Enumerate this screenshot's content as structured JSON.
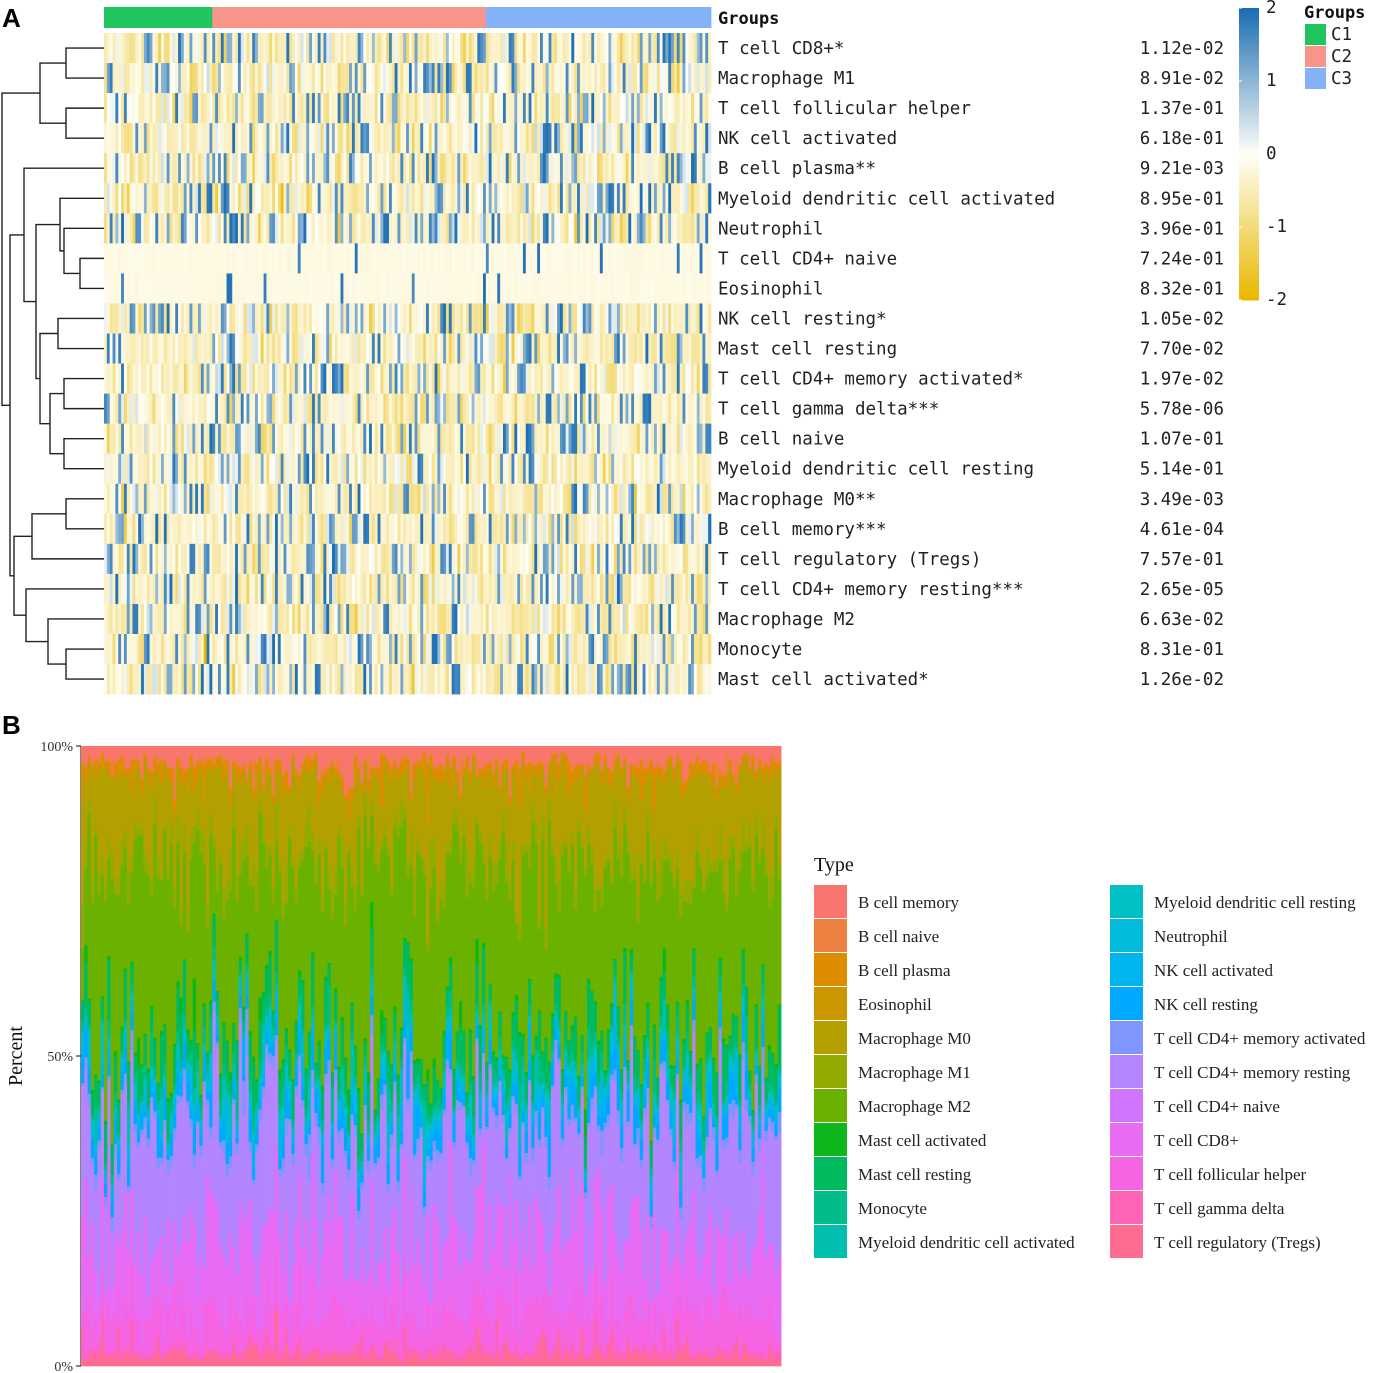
{
  "panels": {
    "a": "A",
    "b": "B"
  },
  "chart_data": [
    {
      "type": "heatmap",
      "title": "",
      "annotation_title": "Groups",
      "groups": [
        {
          "name": "C1",
          "color": "#21C55D",
          "n_samples": 38
        },
        {
          "name": "C2",
          "color": "#F8958A",
          "n_samples": 96
        },
        {
          "name": "C3",
          "color": "#84B2F7",
          "n_samples": 79
        }
      ],
      "rows": [
        {
          "label": "T cell CD8+*",
          "pvalue": "1.12e-02"
        },
        {
          "label": "Macrophage M1",
          "pvalue": "8.91e-02"
        },
        {
          "label": "T cell follicular helper",
          "pvalue": "1.37e-01"
        },
        {
          "label": "NK cell activated",
          "pvalue": "6.18e-01"
        },
        {
          "label": "B cell plasma**",
          "pvalue": "9.21e-03"
        },
        {
          "label": "Myeloid dendritic cell activated",
          "pvalue": "8.95e-01"
        },
        {
          "label": "Neutrophil",
          "pvalue": "3.96e-01"
        },
        {
          "label": "T cell CD4+ naive",
          "pvalue": "7.24e-01"
        },
        {
          "label": "Eosinophil",
          "pvalue": "8.32e-01"
        },
        {
          "label": "NK cell resting*",
          "pvalue": "1.05e-02"
        },
        {
          "label": "Mast cell resting",
          "pvalue": "7.70e-02"
        },
        {
          "label": "T cell CD4+ memory activated*",
          "pvalue": "1.97e-02"
        },
        {
          "label": "T cell gamma delta***",
          "pvalue": "5.78e-06"
        },
        {
          "label": "B cell naive",
          "pvalue": "1.07e-01"
        },
        {
          "label": "Myeloid dendritic cell resting",
          "pvalue": "5.14e-01"
        },
        {
          "label": "Macrophage M0**",
          "pvalue": "3.49e-03"
        },
        {
          "label": "B cell memory***",
          "pvalue": "4.61e-04"
        },
        {
          "label": "T cell regulatory (Tregs)",
          "pvalue": "7.57e-01"
        },
        {
          "label": "T cell CD4+ memory resting***",
          "pvalue": "2.65e-05"
        },
        {
          "label": "Macrophage M2",
          "pvalue": "6.63e-02"
        },
        {
          "label": "Monocyte",
          "pvalue": "8.31e-01"
        },
        {
          "label": "Mast cell activated*",
          "pvalue": "1.26e-02"
        }
      ],
      "color_scale": {
        "min": -2,
        "max": 2,
        "ticks": [
          2,
          1,
          0,
          -1,
          -2
        ],
        "low": "#E8B800",
        "mid": "#FFFFF8",
        "high": "#1C6EB4"
      },
      "legend_title": "Groups",
      "legend_labels": [
        "C1",
        "C2",
        "C3"
      ]
    },
    {
      "type": "bar",
      "stacked": true,
      "ylabel": "Percent",
      "yticks": [
        "0%",
        "50%",
        "100%"
      ],
      "ylim": [
        0,
        100
      ],
      "n_samples": 213,
      "legend_title": "Type",
      "legend": [
        {
          "name": "B cell memory",
          "color": "#F8766D"
        },
        {
          "name": "B cell naive",
          "color": "#EE8042"
        },
        {
          "name": "B cell plasma",
          "color": "#DF8B00"
        },
        {
          "name": "Eosinophil",
          "color": "#CB9600"
        },
        {
          "name": "Macrophage M0",
          "color": "#B3A000"
        },
        {
          "name": "Macrophage M1",
          "color": "#94AA00"
        },
        {
          "name": "Macrophage M2",
          "color": "#6AB100"
        },
        {
          "name": "Mast cell activated",
          "color": "#0BB71A"
        },
        {
          "name": "Mast cell resting",
          "color": "#00BA5F"
        },
        {
          "name": "Monocyte",
          "color": "#00BD8A"
        },
        {
          "name": "Myeloid dendritic cell activated",
          "color": "#00BFAE"
        },
        {
          "name": "Myeloid dendritic cell resting",
          "color": "#00C0C6"
        },
        {
          "name": "Neutrophil",
          "color": "#00BCDA"
        },
        {
          "name": "NK cell activated",
          "color": "#00B5EE"
        },
        {
          "name": "NK cell resting",
          "color": "#00A9FF"
        },
        {
          "name": "T cell CD4+ memory activated",
          "color": "#7F96FF"
        },
        {
          "name": "T cell CD4+ memory resting",
          "color": "#B385FF"
        },
        {
          "name": "T cell CD4+ naive",
          "color": "#D174FF"
        },
        {
          "name": "T cell CD8+",
          "color": "#E76BF3"
        },
        {
          "name": "T cell follicular helper",
          "color": "#F564E3"
        },
        {
          "name": "T cell gamma delta",
          "color": "#FF63B6"
        },
        {
          "name": "T cell regulatory (Tregs)",
          "color": "#FF6C91"
        }
      ]
    }
  ]
}
